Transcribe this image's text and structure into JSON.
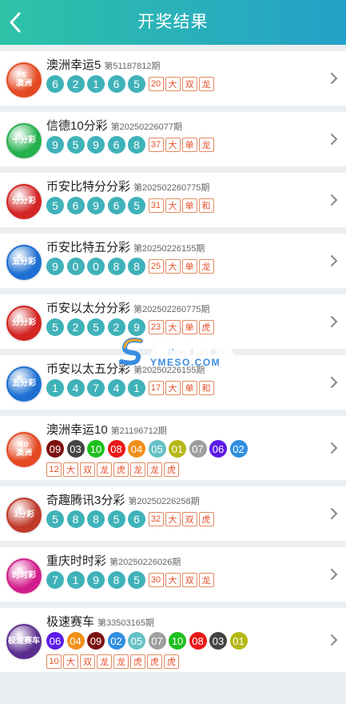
{
  "header": {
    "title": "开奖结果",
    "back_icon": "chevron-left-icon"
  },
  "colors": {
    "teal": "#3fb2b9",
    "tag_text": "#e8502a",
    "tag_border": "#e08a63"
  },
  "ball_colors": {
    "01": "#b4b814",
    "02": "#2f8ee0",
    "03": "#434343",
    "04": "#f28f19",
    "05": "#65c1c6",
    "06": "#5c1be8",
    "07": "#9e9e9e",
    "08": "#eb1818",
    "09": "#7d0f0f",
    "10": "#1ec01e"
  },
  "lotteries": [
    {
      "name": "澳洲幸运5",
      "issue": "第51187812期",
      "logo": {
        "text": "5\n澳洲",
        "color": "#e54923",
        "icon": "lucky5-logo"
      },
      "balls": [
        "6",
        "2",
        "1",
        "6",
        "5"
      ],
      "tags": [
        "20",
        "大",
        "双",
        "龙"
      ],
      "style": "teal"
    },
    {
      "name": "信德10分彩",
      "issue": "第20250226077期",
      "logo": {
        "text": "十分彩",
        "color": "#24b04d",
        "icon": "ten-minute-logo"
      },
      "balls": [
        "9",
        "5",
        "9",
        "6",
        "8"
      ],
      "tags": [
        "37",
        "大",
        "单",
        "龙"
      ],
      "style": "teal"
    },
    {
      "name": "币安比特分分彩",
      "issue": "第202502260775期",
      "logo": {
        "text": "分分彩",
        "color": "#d42424",
        "icon": "minute-logo"
      },
      "balls": [
        "5",
        "6",
        "9",
        "6",
        "5"
      ],
      "tags": [
        "31",
        "大",
        "单",
        "和"
      ],
      "style": "teal"
    },
    {
      "name": "币安比特五分彩",
      "issue": "第20250226155期",
      "logo": {
        "text": "五分彩",
        "color": "#1d6fd1",
        "icon": "five-minute-logo"
      },
      "balls": [
        "9",
        "0",
        "0",
        "8",
        "8"
      ],
      "tags": [
        "25",
        "大",
        "单",
        "龙"
      ],
      "style": "teal"
    },
    {
      "name": "币安以太分分彩",
      "issue": "第202502260775期",
      "logo": {
        "text": "分分彩",
        "color": "#d42424",
        "icon": "minute-logo"
      },
      "balls": [
        "5",
        "2",
        "5",
        "2",
        "9"
      ],
      "tags": [
        "23",
        "大",
        "单",
        "虎"
      ],
      "style": "teal"
    },
    {
      "name": "币安以太五分彩",
      "issue": "第20250226155期",
      "logo": {
        "text": "五分彩",
        "color": "#1d6fd1",
        "icon": "five-minute-logo"
      },
      "balls": [
        "1",
        "4",
        "7",
        "4",
        "1"
      ],
      "tags": [
        "17",
        "大",
        "单",
        "和"
      ],
      "style": "teal"
    },
    {
      "name": "澳洲幸运10",
      "issue": "第21196712期",
      "logo": {
        "text": "10\n澳洲",
        "color": "#e54923",
        "icon": "lucky10-logo"
      },
      "balls": [
        "09",
        "03",
        "10",
        "08",
        "04",
        "05",
        "01",
        "07",
        "06",
        "02"
      ],
      "tags": [
        "12",
        "大",
        "双",
        "龙",
        "虎",
        "龙",
        "龙",
        "虎"
      ],
      "style": "color"
    },
    {
      "name": "奇趣腾讯3分彩",
      "issue": "第20250226258期",
      "logo": {
        "text": "3分彩",
        "color": "#c0392b",
        "icon": "three-minute-logo"
      },
      "balls": [
        "5",
        "8",
        "8",
        "5",
        "6"
      ],
      "tags": [
        "32",
        "大",
        "双",
        "虎"
      ],
      "style": "teal"
    },
    {
      "name": "重庆时时彩",
      "issue": "第20250226026期",
      "logo": {
        "text": "时时彩",
        "color": "#d21e8c",
        "icon": "ssc-logo"
      },
      "balls": [
        "7",
        "1",
        "9",
        "8",
        "5"
      ],
      "tags": [
        "30",
        "大",
        "双",
        "龙"
      ],
      "style": "teal"
    },
    {
      "name": "极速赛车",
      "issue": "第33503165期",
      "logo": {
        "text": "极速赛车",
        "color": "#5b2c8f",
        "icon": "racing-logo"
      },
      "balls": [
        "06",
        "04",
        "09",
        "02",
        "05",
        "07",
        "10",
        "08",
        "03",
        "01"
      ],
      "tags": [
        "10",
        "大",
        "双",
        "龙",
        "龙",
        "虎",
        "虎",
        "虎"
      ],
      "style": "color"
    }
  ],
  "watermark": {
    "title": "源码商城",
    "sub": "YMESO.COM"
  }
}
